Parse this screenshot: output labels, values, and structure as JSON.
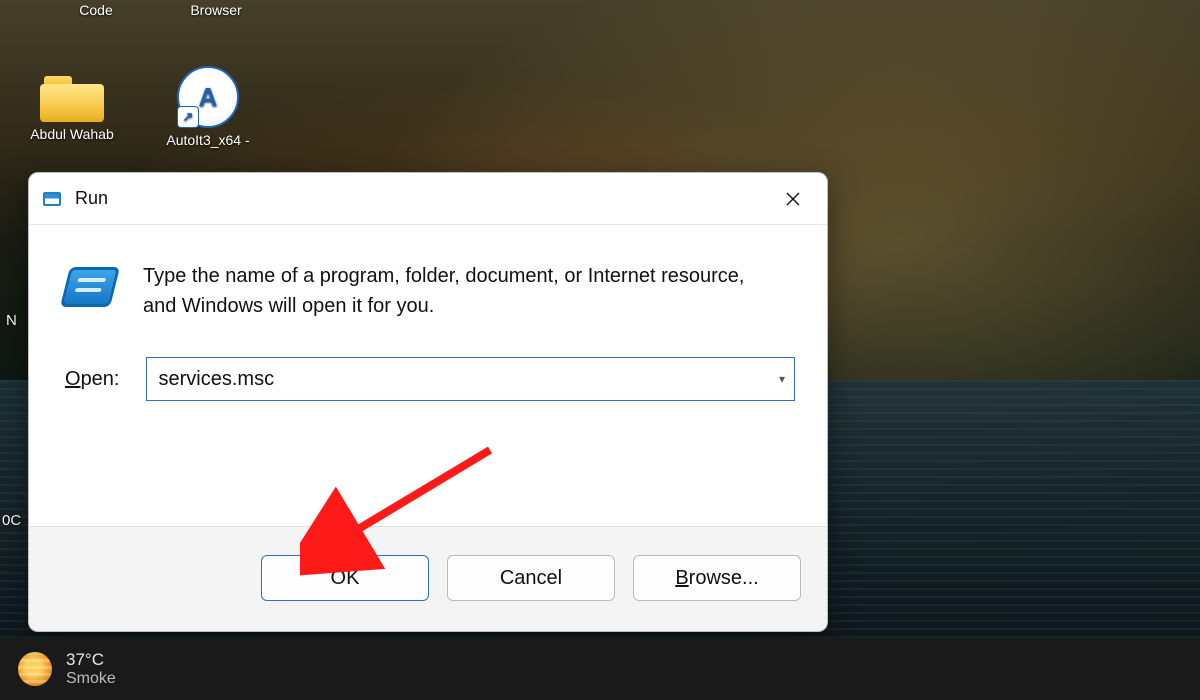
{
  "desktop": {
    "icons": [
      {
        "label": "Code"
      },
      {
        "label": "Browser"
      },
      {
        "label": "Abdul Wahab"
      },
      {
        "label": "AutoIt3_x64 -"
      }
    ],
    "edge_fragments": {
      "a": "N",
      "b": "0C"
    }
  },
  "run_dialog": {
    "title": "Run",
    "description": "Type the name of a program, folder, document, or Internet resource, and Windows will open it for you.",
    "open_label_pre": "O",
    "open_label_post": "pen:",
    "input_value": "services.msc",
    "buttons": {
      "ok": "OK",
      "cancel": "Cancel",
      "browse_pre": "B",
      "browse_post": "rowse..."
    }
  },
  "taskbar": {
    "temperature": "37°C",
    "condition": "Smoke"
  }
}
